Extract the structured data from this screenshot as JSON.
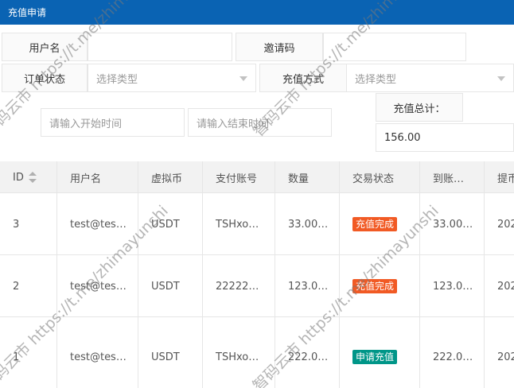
{
  "title": "充值申请",
  "filters": {
    "username_label": "用户名",
    "invite_label": "邀请码",
    "status_label": "订单状态",
    "status_placeholder": "选择类型",
    "method_label": "充值方式",
    "method_placeholder": "选择类型",
    "start_placeholder": "请输入开始时间",
    "end_placeholder": "请输入结束时间",
    "total_label": "充值总计：",
    "total_value": "156.00"
  },
  "table": {
    "columns": [
      "ID",
      "用户名",
      "虚拟币",
      "支付账号",
      "数量",
      "交易状态",
      "到账…",
      "提币"
    ],
    "rows": [
      {
        "id": "3",
        "user": "test@tes…",
        "coin": "USDT",
        "account": "TSHxo…",
        "amount": "33.00…",
        "status": "充值完成",
        "status_color": "#f15a24",
        "received": "33.00…",
        "withdraw": "202"
      },
      {
        "id": "2",
        "user": "test@tes…",
        "coin": "USDT",
        "account": "22222…",
        "amount": "123.0…",
        "status": "充值完成",
        "status_color": "#f15a24",
        "received": "123.0…",
        "withdraw": "202"
      },
      {
        "id": "1",
        "user": "test@tes…",
        "coin": "USDT",
        "account": "TSHxo…",
        "amount": "222.0…",
        "status": "申请充值",
        "status_color": "#009688",
        "received": "222.0…",
        "withdraw": "202"
      }
    ]
  },
  "watermark": "智码云市 https://t.me/zhimayunshi",
  "colors": {
    "header": "#0a63b3",
    "done": "#f15a24",
    "applied": "#009688"
  }
}
